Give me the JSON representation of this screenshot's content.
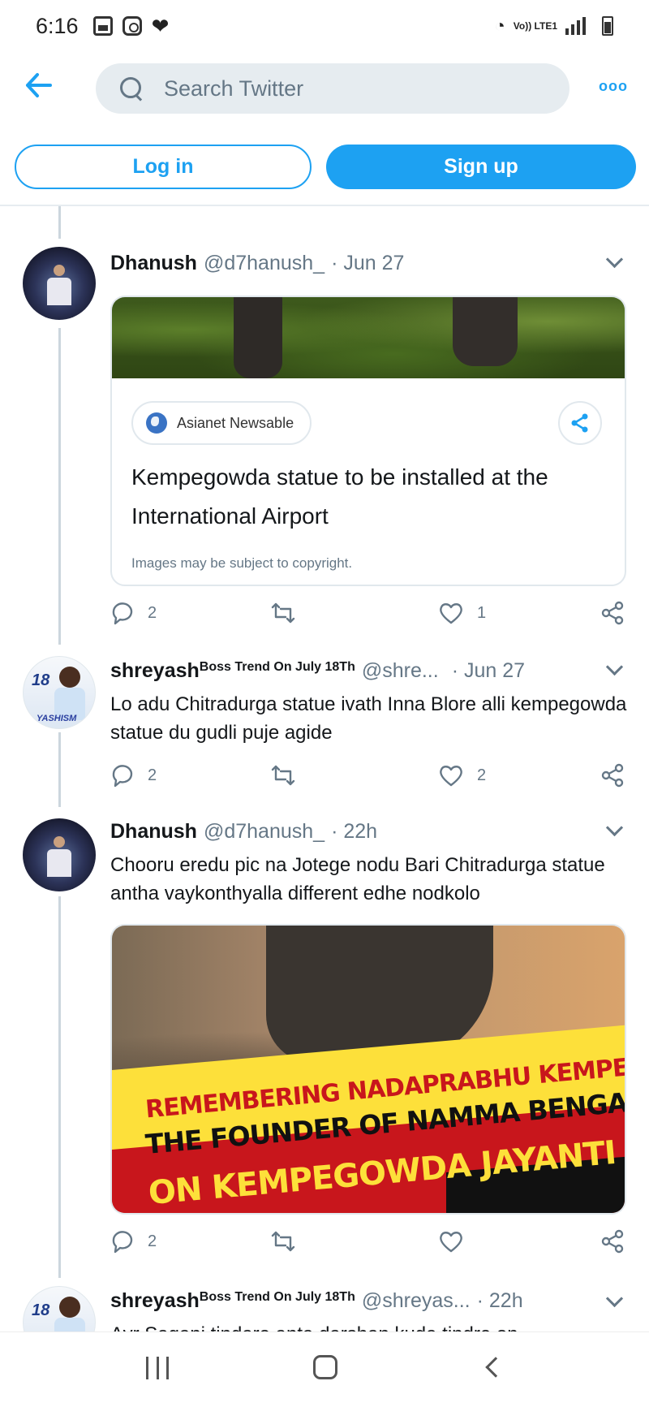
{
  "status_bar": {
    "time": "6:16",
    "network_label": "Vo)) LTE1",
    "icons": [
      "gallery-icon",
      "instagram-icon",
      "heart-icon",
      "wifi-icon",
      "signal-icon",
      "battery-icon"
    ]
  },
  "search": {
    "placeholder": "Search Twitter",
    "icons": [
      "back-arrow-icon",
      "search-icon",
      "more-options-icon"
    ]
  },
  "auth": {
    "login_label": "Log in",
    "signup_label": "Sign up"
  },
  "tweets": [
    {
      "name": "Dhanush",
      "badge": "",
      "handle": "@d7hanush_",
      "time": "· Jun 27",
      "text": "",
      "card": {
        "source": "Asianet Newsable",
        "title": "Kempegowda statue to be installed at the International Airport",
        "note": "Images may be subject to copyright."
      },
      "replies": "2",
      "retweets": "",
      "likes": "1"
    },
    {
      "name": "shreyash",
      "badge": "Boss Trend On July 18Th",
      "handle": "@shre...",
      "time": "· Jun 27",
      "text": "Lo adu Chitradurga statue ivath Inna Blore alli kempegowda statue du gudli puje agide",
      "replies": "2",
      "retweets": "",
      "likes": "2"
    },
    {
      "name": "Dhanush",
      "badge": "",
      "handle": "@d7hanush_",
      "time": "· 22h",
      "text": "Chooru eredu pic na Jotege nodu Bari Chitradurga statue antha vaykonthyalla different edhe nodkolo",
      "image": {
        "line1": "REMEMBERING NADAPRABHU KEMPEGOWDA",
        "line2": "THE FOUNDER OF NAMMA BENGALURU",
        "line3": "ON KEMPEGOWDA JAYANTI"
      },
      "replies": "2",
      "retweets": "",
      "likes": ""
    },
    {
      "name": "shreyash",
      "badge": "Boss Trend On July 18Th",
      "handle": "@shreyas...",
      "time": "· 22h",
      "text": "Ayr Saganj tindare anta darshan kuda tindre on"
    }
  ],
  "avatars": {
    "shreyash_avatar_text": "18",
    "shreyash_avatar_name": "YASHISM"
  },
  "colors": {
    "accent": "#1da1f2",
    "secondary_text": "#657786",
    "search_bg": "#e6ecf0"
  }
}
